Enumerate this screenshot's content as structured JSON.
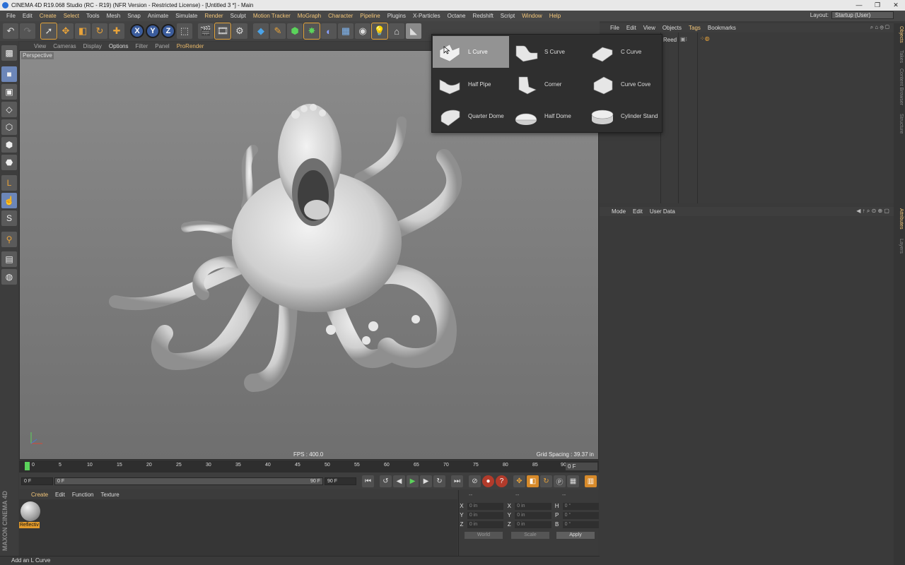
{
  "window": {
    "title": "CINEMA 4D R19.068 Studio (RC - R19) (NFR Version - Restricted License) - [Untitled 3 *] - Main"
  },
  "menubar": [
    "File",
    "Edit",
    "Create",
    "Select",
    "Tools",
    "Mesh",
    "Snap",
    "Animate",
    "Simulate",
    "Render",
    "Sculpt",
    "Motion Tracker",
    "MoGraph",
    "Character",
    "Pipeline",
    "Plugins",
    "X-Particles",
    "Octane",
    "Redshift",
    "Script",
    "Window",
    "Help"
  ],
  "layout": {
    "label": "Layout:",
    "value": "Startup (User)"
  },
  "viewport": {
    "menu": [
      "View",
      "Cameras",
      "Display",
      "Options",
      "Filter",
      "Panel",
      "ProRender"
    ],
    "label": "Perspective",
    "fps": "FPS : 400.0",
    "grid_spacing": "Grid Spacing : 39.37 in"
  },
  "timeline": {
    "ticks": [
      "0",
      "5",
      "10",
      "15",
      "20",
      "25",
      "30",
      "35",
      "40",
      "45",
      "50",
      "55",
      "60",
      "65",
      "70",
      "75",
      "80",
      "85",
      "90"
    ],
    "current_frame": "0 F"
  },
  "transport": {
    "start": "0 F",
    "range_start": "0 F",
    "range_end": "90 F",
    "end": "90 F"
  },
  "material_manager": {
    "menu": [
      "Create",
      "Edit",
      "Function",
      "Texture"
    ],
    "material_name": "Reflectiv"
  },
  "coordinates": {
    "header": "--",
    "rows": [
      {
        "a": "X",
        "av": "0 in",
        "b": "X",
        "bv": "0 in",
        "c": "H",
        "cv": "0 °"
      },
      {
        "a": "Y",
        "av": "0 in",
        "b": "Y",
        "bv": "0 in",
        "c": "P",
        "cv": "0 °"
      },
      {
        "a": "Z",
        "av": "0 in",
        "b": "Z",
        "bv": "0 in",
        "c": "B",
        "cv": "0 °"
      }
    ],
    "world": "World",
    "scale": "Scale",
    "apply": "Apply"
  },
  "status": "Add an L Curve",
  "object_manager": {
    "menu": [
      "File",
      "Edit",
      "View",
      "Objects",
      "Tags",
      "Bookmarks"
    ],
    "object": "Reed"
  },
  "attribute_manager": {
    "menu": [
      "Mode",
      "Edit",
      "User Data"
    ]
  },
  "right_tabs": [
    "Objects",
    "Takes",
    "Content Browser",
    "Structure",
    "Attributes",
    "Layers"
  ],
  "popup": {
    "items": [
      "L Curve",
      "S Curve",
      "C Curve",
      "Half Pipe",
      "Corner",
      "Curve Cove",
      "Quarter Dome",
      "Half Dome",
      "Cylinder Stand"
    ],
    "selected_index": 0
  },
  "maxon_logo": "MAXON CINEMA 4D",
  "colors": {
    "accent": "#e3a43c",
    "menu_highlight": "#f4c77a"
  }
}
